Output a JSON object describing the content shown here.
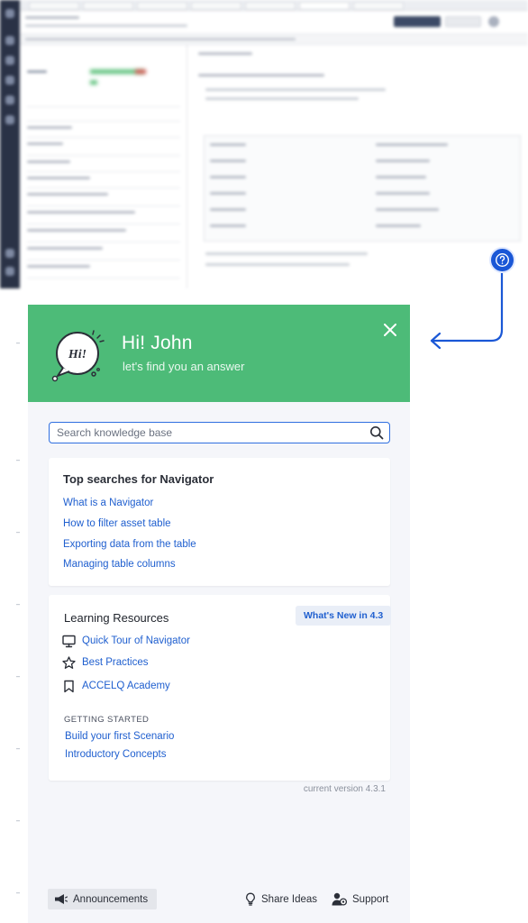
{
  "widget": {
    "logo_text": "Hi!",
    "greeting": "Hi! John",
    "subgreeting": "let's find you an answer",
    "search": {
      "placeholder": "Search knowledge base"
    },
    "top_searches": {
      "title": "Top searches for Navigator",
      "links": [
        "What is a Navigator",
        "How to filter asset table",
        "Exporting data from the table",
        "Managing table columns"
      ]
    },
    "learning": {
      "title": "Learning Resources",
      "whats_new": "What's New in 4.3",
      "resources": [
        {
          "label": "Quick Tour of Navigator",
          "icon": "monitor-icon"
        },
        {
          "label": "Best Practices",
          "icon": "star-icon"
        },
        {
          "label": "ACCELQ Academy",
          "icon": "bookmark-icon"
        }
      ],
      "getting_started_label": "GETTING STARTED",
      "getting_started_links": [
        "Build your first Scenario",
        "Introductory Concepts"
      ]
    },
    "version": "current version 4.3.1",
    "footer": {
      "announcements": "Announcements",
      "share_ideas": "Share Ideas",
      "support": "Support"
    }
  },
  "colors": {
    "header_green": "#4dbb78",
    "link_blue": "#1f5fcf",
    "help_button_blue": "#1a57d6",
    "panel_bg": "#f5f6fa"
  }
}
